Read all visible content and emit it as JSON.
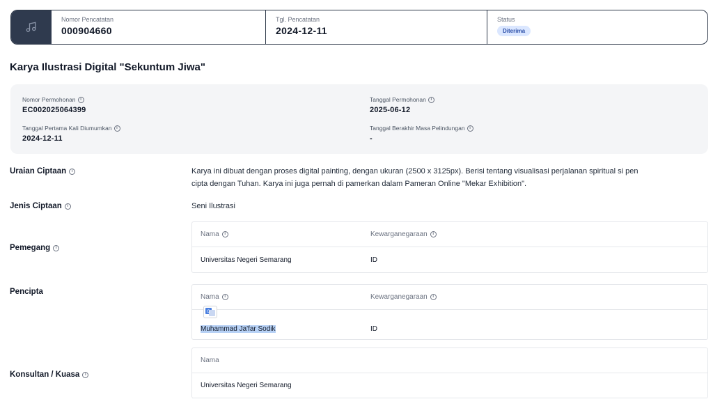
{
  "header": {
    "icon": "music-note-icon",
    "nomor_pencatatan_label": "Nomor Pencatatan",
    "nomor_pencatatan_value": "000904660",
    "tgl_pencatatan_label": "Tgl. Pencatatan",
    "tgl_pencatatan_value": "2024-12-11",
    "status_label": "Status",
    "status_value": "Diterima"
  },
  "title": "Karya Ilustrasi Digital \"Sekuntum Jiwa\"",
  "info": {
    "nomor_permohonan_label": "Nomor Permohonan",
    "nomor_permohonan_value": "EC002025064399",
    "tanggal_permohonan_label": "Tanggal Permohonan",
    "tanggal_permohonan_value": "2025-06-12",
    "tanggal_diumumkan_label": "Tanggal Pertama Kali Diumumkan",
    "tanggal_diumumkan_value": "2024-12-11",
    "tanggal_berakhir_label": "Tanggal Berakhir Masa Pelindungan",
    "tanggal_berakhir_value": "-"
  },
  "uraian": {
    "label": "Uraian Ciptaan",
    "line1": "Karya ini dibuat dengan proses digital painting, dengan ukuran (2500 x 3125px). Berisi tentang visualisasi perjalanan spiritual si pen",
    "line2": "cipta dengan Tuhan. Karya ini juga pernah di pamerkan dalam Pameran Online \"Mekar Exhibition\"."
  },
  "jenis": {
    "label": "Jenis Ciptaan",
    "value": "Seni Ilustrasi"
  },
  "pemegang": {
    "label": "Pemegang",
    "col_nama": "Nama",
    "col_kewarganegaraan": "Kewarganegaraan",
    "nama": "Universitas Negeri Semarang",
    "kewarganegaraan": "ID"
  },
  "pencipta": {
    "label": "Pencipta",
    "col_nama": "Nama",
    "col_kewarganegaraan": "Kewarganegaraan",
    "nama": "Muhammad Ja'far Sodik",
    "kewarganegaraan": "ID"
  },
  "konsultan": {
    "label": "Konsultan / Kuasa",
    "col_nama": "Nama",
    "nama": "Universitas Negeri Semarang"
  },
  "colors": {
    "accent_dark": "#2f3a4e",
    "badge_bg": "#dbe7ff",
    "badge_text": "#2b4ea8",
    "selection": "#b7d1f5"
  }
}
